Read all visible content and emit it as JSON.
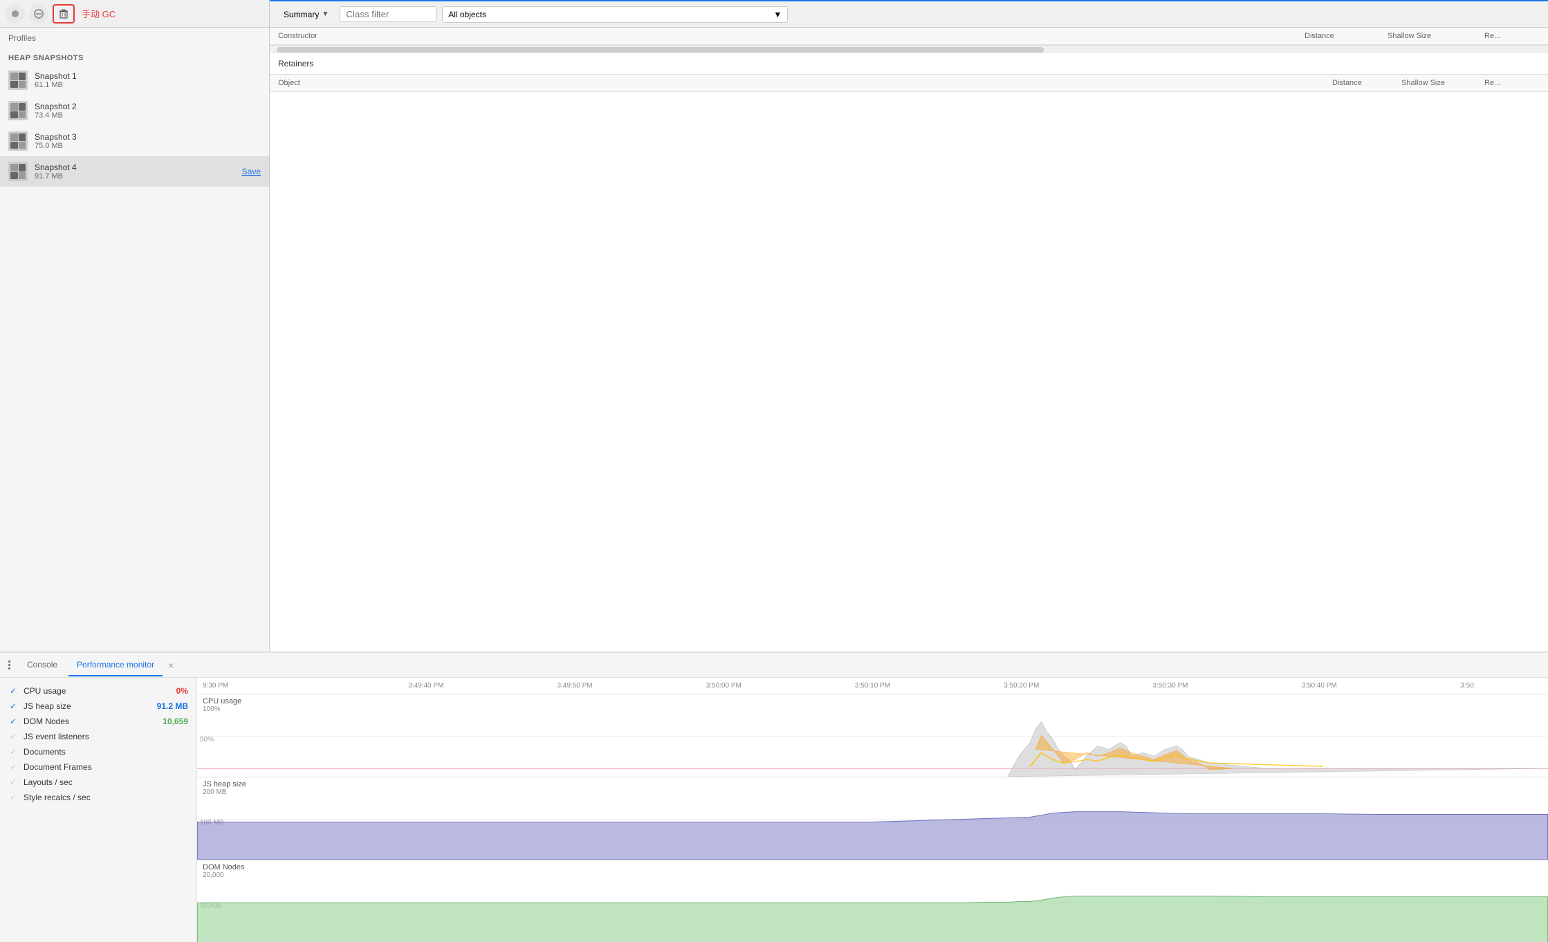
{
  "toolbar": {
    "gc_label": "手动 GC",
    "summary_label": "Summary",
    "class_filter_label": "Class filter",
    "all_objects_label": "All objects"
  },
  "sidebar": {
    "profiles_label": "Profiles",
    "heap_snapshots_label": "HEAP SNAPSHOTS",
    "snapshots": [
      {
        "name": "Snapshot 1",
        "size": "61.1 MB",
        "active": false
      },
      {
        "name": "Snapshot 2",
        "size": "73.4 MB",
        "active": false
      },
      {
        "name": "Snapshot 3",
        "size": "75.0 MB",
        "active": false
      },
      {
        "name": "Snapshot 4",
        "size": "91.7 MB",
        "active": true,
        "save": "Save"
      }
    ]
  },
  "content": {
    "constructor_col": "Constructor",
    "distance_col": "Distance",
    "shallow_size_col": "Shallow Size",
    "retained_col": "Re...",
    "retainers_title": "Retainers",
    "object_col": "Object",
    "distance_col2": "Distance",
    "shallow_size_col2": "Shallow Size",
    "retained_col2": "Re..."
  },
  "bottom": {
    "tabs": [
      {
        "label": "Console",
        "active": false,
        "closable": false
      },
      {
        "label": "Performance monitor",
        "active": true,
        "closable": true
      }
    ]
  },
  "perf": {
    "metrics": [
      {
        "name": "CPU usage",
        "value": "0%",
        "color": "red",
        "checked": true
      },
      {
        "name": "JS heap size",
        "value": "91.2 MB",
        "color": "blue",
        "checked": true
      },
      {
        "name": "DOM Nodes",
        "value": "10,659",
        "color": "green",
        "checked": true
      },
      {
        "name": "JS event listeners",
        "value": "",
        "color": "",
        "checked": false
      },
      {
        "name": "Documents",
        "value": "",
        "color": "",
        "checked": false
      },
      {
        "name": "Document Frames",
        "value": "",
        "color": "",
        "checked": false
      },
      {
        "name": "Layouts / sec",
        "value": "",
        "color": "",
        "checked": false
      },
      {
        "name": "Style recalcs / sec",
        "value": "",
        "color": "",
        "checked": false
      }
    ],
    "time_labels": [
      "9:30 PM",
      "3:49:40 PM",
      "3:49:50 PM",
      "3:50:00 PM",
      "3:50:10 PM",
      "3:50:20 PM",
      "3:50:30 PM",
      "3:50:40 PM",
      "3:50:"
    ],
    "cpu_chart": {
      "title": "CPU usage",
      "labels": [
        "100%",
        "50%"
      ]
    },
    "heap_chart": {
      "title": "JS heap size",
      "labels": [
        "200 MB",
        "100 MB"
      ]
    },
    "dom_chart": {
      "title": "DOM Nodes",
      "labels": [
        "20,000",
        "10,000"
      ]
    }
  }
}
